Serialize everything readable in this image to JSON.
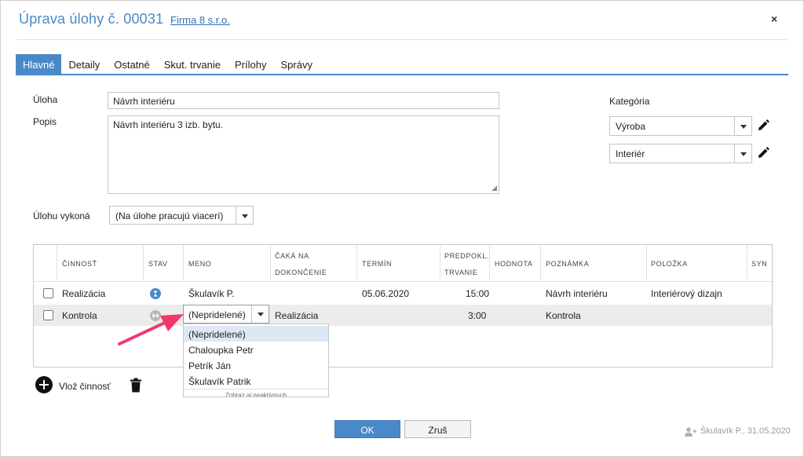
{
  "dialog": {
    "title": "Úprava úlohy č. 00031",
    "company_link": "Firma 8 s.r.o.",
    "close_label": "×"
  },
  "tabs": [
    {
      "label": "Hlavné",
      "active": true
    },
    {
      "label": "Detaily"
    },
    {
      "label": "Ostatné"
    },
    {
      "label": "Skut. trvanie"
    },
    {
      "label": "Prílohy"
    },
    {
      "label": "Správy"
    }
  ],
  "form": {
    "task_label": "Úloha",
    "task_value": "Návrh interiéru",
    "description_label": "Popis",
    "description_value": "Návrh interiéru 3 izb. bytu.",
    "assignee_label": "Úlohu vykoná",
    "assignee_value": "(Na úlohe pracujú viacerí)",
    "category_label": "Kategória",
    "category1_value": "Výroba",
    "category2_value": "Interiér"
  },
  "grid": {
    "columns": {
      "activity": "ČINNOSŤ",
      "status": "STAV",
      "name": "MENO",
      "waits_1": "ČAKÁ NA",
      "waits_2": "DOKONČENIE",
      "deadline": "TERMÍN",
      "expected_1": "PREDPOKL.",
      "expected_2": "TRVANIE",
      "value": "HODNOTA",
      "note": "POZNÁMKA",
      "item": "POLOŽKA",
      "syn": "SYN"
    },
    "rows": [
      {
        "activity": "Realizácia",
        "status_color": "#4a89c8",
        "name": "Škulavík P.",
        "waits": "",
        "deadline": "05.06.2020",
        "duration": "15:00",
        "value": "",
        "note": "Návrh interiéru",
        "item": "Interiérový dizajn"
      },
      {
        "activity": "Kontrola",
        "status_color": "#b8b8b8",
        "name": "(Nepridelené)",
        "waits": "Realizácia",
        "deadline": "",
        "duration": "3:00",
        "value": "",
        "note": "Kontrola",
        "item": ""
      }
    ]
  },
  "dropdown": {
    "options": [
      "(Nepridelené)",
      "Chaloupka Petr",
      "Petrík Ján",
      "Škulavík Patrik"
    ],
    "more_label": "Zobraz aj neaktívnych"
  },
  "actions": {
    "add_activity_label": "Vlož činnosť",
    "ok_label": "OK",
    "cancel_label": "Zruš"
  },
  "footer": {
    "author_text": "Škulavík P., 31.05.2020"
  },
  "colors": {
    "accent": "#4a89c8",
    "arrow_annotation": "#f0386b"
  }
}
